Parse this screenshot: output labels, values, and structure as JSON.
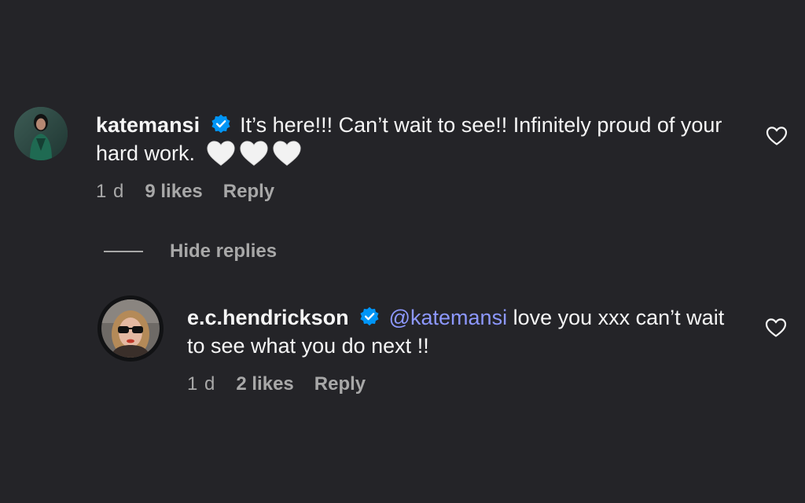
{
  "comments": [
    {
      "username": "katemansi",
      "verified": true,
      "text": "It’s here!!! Can’t wait to see!! Infinitely proud of your hard work.",
      "hearts": "🤍🤍🤍",
      "time": "1 d",
      "likes": "9 likes",
      "reply_label": "Reply"
    }
  ],
  "hide_replies_label": "Hide replies",
  "replies": [
    {
      "username": "e.c.hendrickson",
      "verified": true,
      "mention": "@katemansi",
      "text": " love you xxx can’t wait to see what you do next !!",
      "time": "1 d",
      "likes": "2 likes",
      "reply_label": "Reply"
    }
  ],
  "colors": {
    "background": "#242428",
    "text": "#f5f5f5",
    "muted": "#a8a8a8",
    "mention": "#8d98ff",
    "verified_badge": "#0095f6"
  },
  "icons": {
    "verified": "verified-badge-icon",
    "like": "heart-outline-icon",
    "white_heart": "white-heart-emoji"
  }
}
